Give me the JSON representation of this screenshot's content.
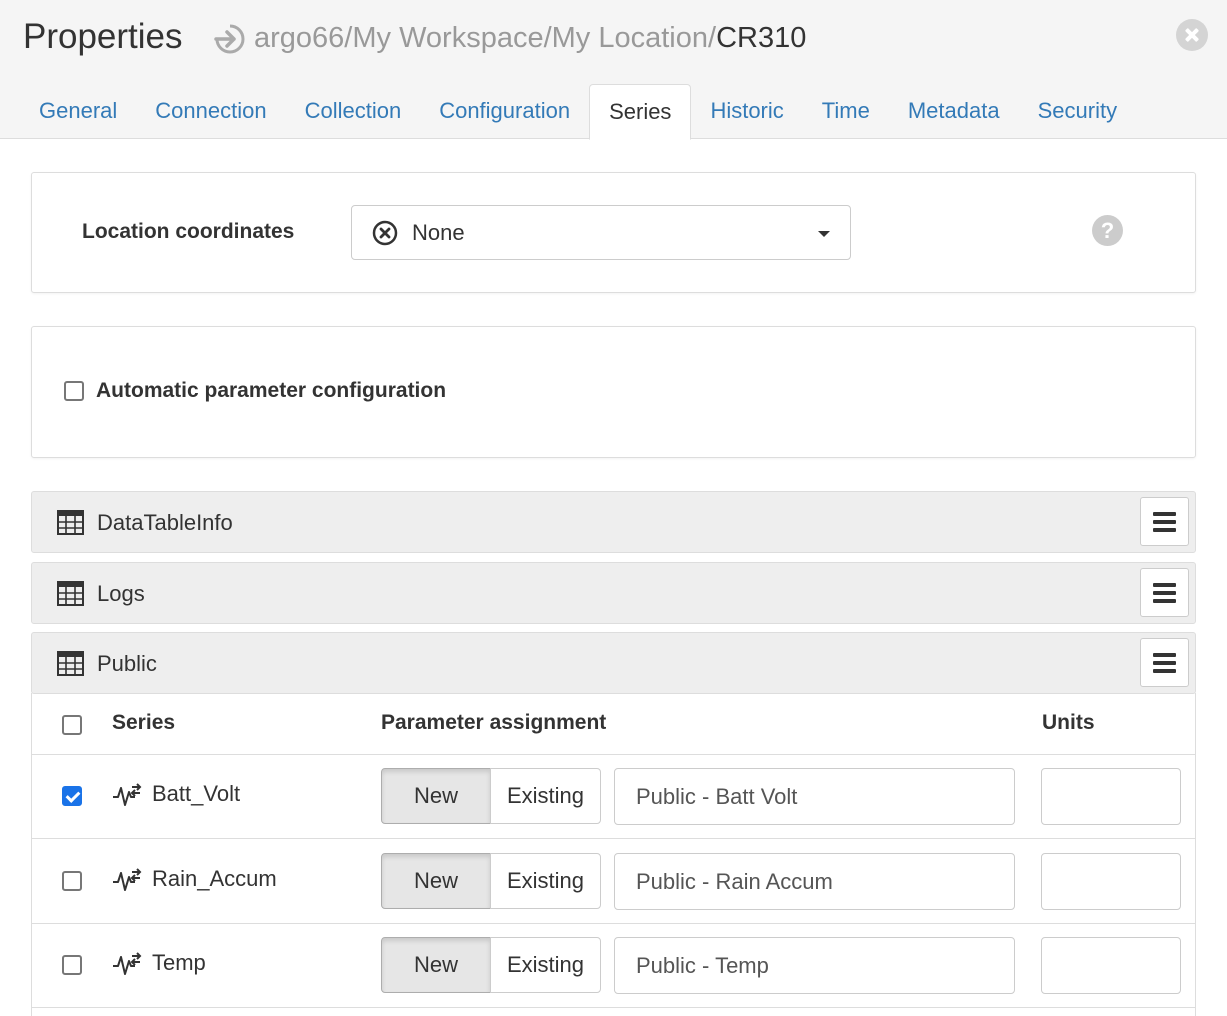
{
  "header": {
    "title": "Properties",
    "path_prefix": "argo66/My Workspace/My Location/",
    "path_current": "CR310"
  },
  "tabs": [
    {
      "label": "General",
      "active": false
    },
    {
      "label": "Connection",
      "active": false
    },
    {
      "label": "Collection",
      "active": false
    },
    {
      "label": "Configuration",
      "active": false
    },
    {
      "label": "Series",
      "active": true
    },
    {
      "label": "Historic",
      "active": false
    },
    {
      "label": "Time",
      "active": false
    },
    {
      "label": "Metadata",
      "active": false
    },
    {
      "label": "Security",
      "active": false
    }
  ],
  "location": {
    "label": "Location coordinates",
    "selected": "None",
    "help": "?"
  },
  "auto_config": {
    "label": "Automatic parameter configuration",
    "checked": false
  },
  "groups": [
    {
      "name": "DataTableInfo"
    },
    {
      "name": "Logs"
    },
    {
      "name": "Public"
    }
  ],
  "series_table": {
    "headers": {
      "series": "Series",
      "parameter": "Parameter assignment",
      "units": "Units"
    },
    "new_label": "New",
    "existing_label": "Existing",
    "rows": [
      {
        "name": "Batt_Volt",
        "checked": true,
        "parameter": "Public - Batt Volt",
        "units": ""
      },
      {
        "name": "Rain_Accum",
        "checked": false,
        "parameter": "Public - Rain Accum",
        "units": ""
      },
      {
        "name": "Temp",
        "checked": false,
        "parameter": "Public - Temp",
        "units": ""
      }
    ]
  },
  "colors": {
    "link": "#337ab7",
    "checkbox_checked": "#1a73e8",
    "group_bg": "#eeeeee"
  }
}
